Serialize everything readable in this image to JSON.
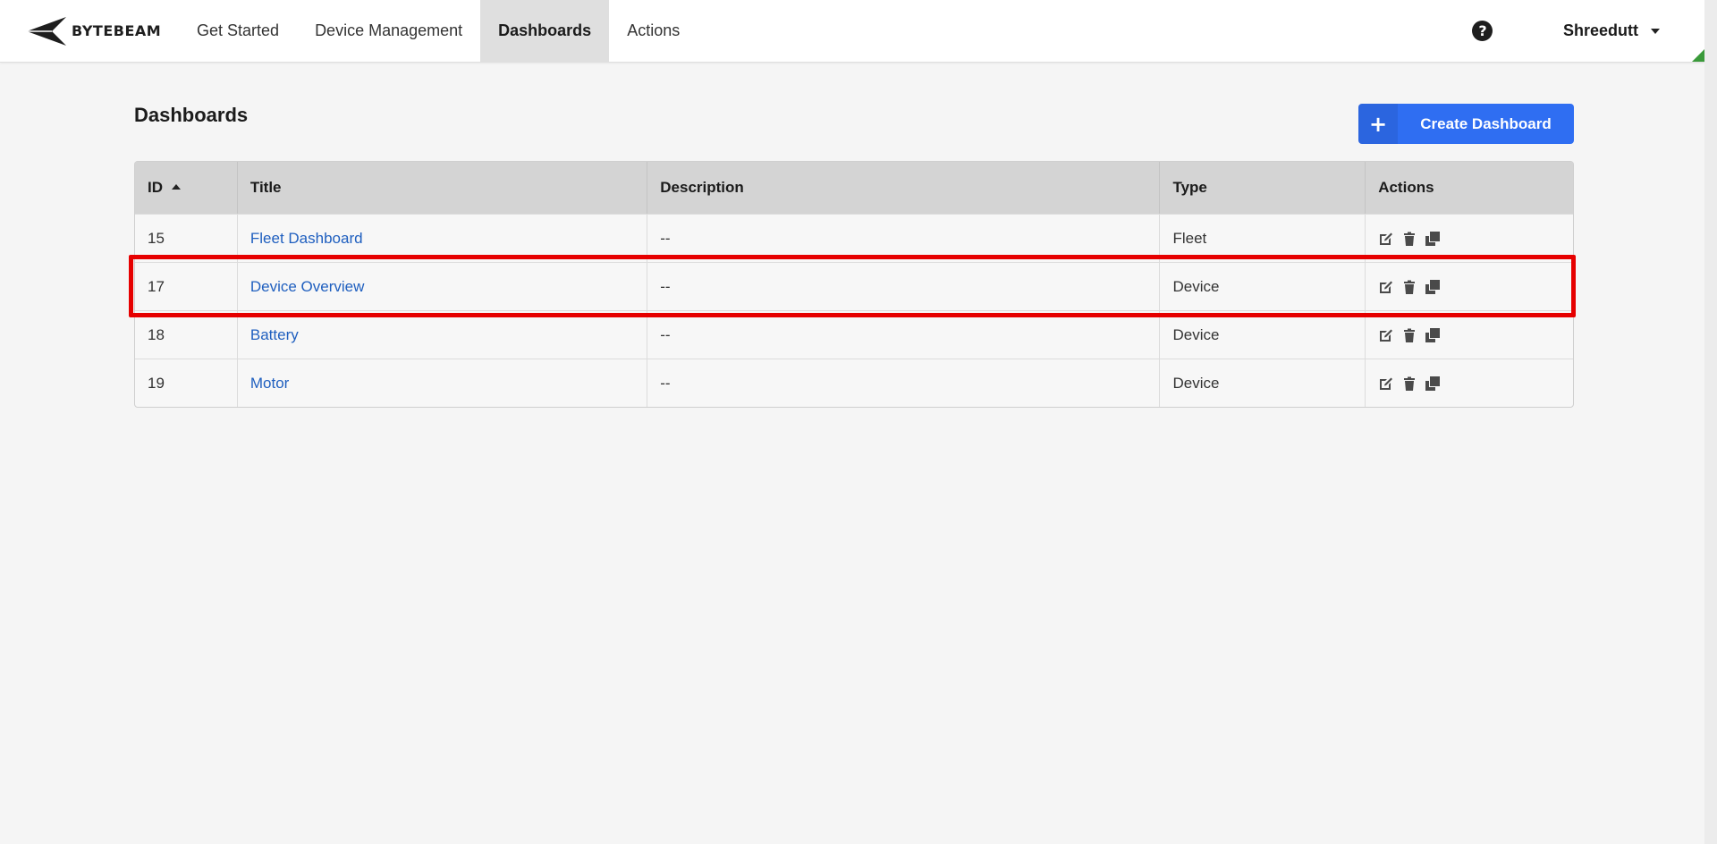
{
  "brand": {
    "name": "BYTEBEAM"
  },
  "nav": {
    "items": [
      {
        "label": "Get Started",
        "active": false
      },
      {
        "label": "Device Management",
        "active": false
      },
      {
        "label": "Dashboards",
        "active": true
      },
      {
        "label": "Actions",
        "active": false
      }
    ],
    "help_icon": "question-circle-icon",
    "help_glyph": "?",
    "user": "Shreedutt"
  },
  "page": {
    "title": "Dashboards",
    "create_button": {
      "icon": "plus-icon",
      "glyph": "+",
      "label": "Create Dashboard"
    }
  },
  "table": {
    "headers": {
      "id": "ID",
      "title": "Title",
      "description": "Description",
      "type": "Type",
      "actions": "Actions"
    },
    "sort": {
      "column": "ID",
      "direction": "ascending"
    },
    "rows": [
      {
        "id": "15",
        "title": "Fleet Dashboard",
        "description": "--",
        "type": "Fleet"
      },
      {
        "id": "17",
        "title": "Device Overview",
        "description": "--",
        "type": "Device",
        "highlighted": true
      },
      {
        "id": "18",
        "title": "Battery",
        "description": "--",
        "type": "Device"
      },
      {
        "id": "19",
        "title": "Motor",
        "description": "--",
        "type": "Device"
      }
    ],
    "row_action_icons": [
      "edit-icon",
      "trash-icon",
      "copy-icon"
    ]
  },
  "colors": {
    "accent": "#2f6ef2",
    "link": "#1f5fbf",
    "highlight": "#e60000",
    "active_nav_bg": "#dfdfdf"
  }
}
